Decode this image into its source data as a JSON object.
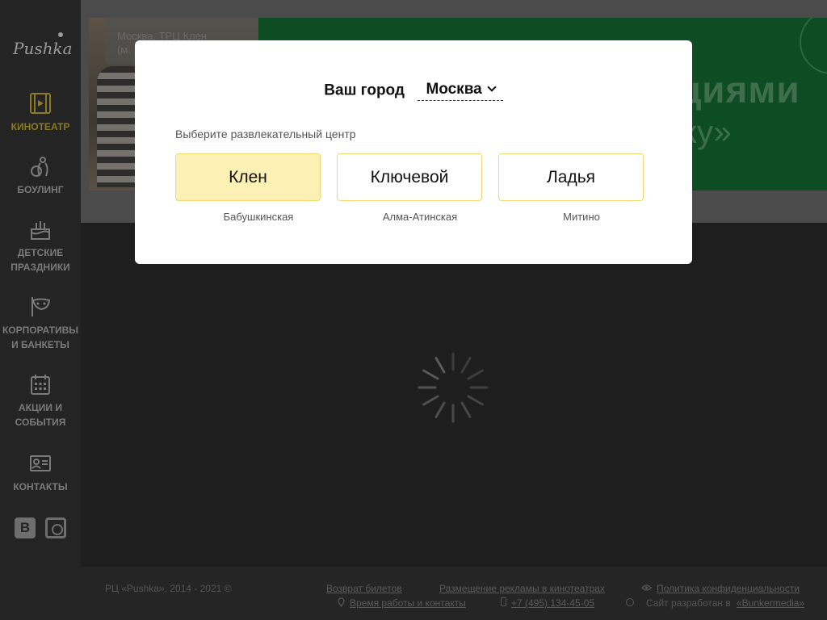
{
  "sidebar": {
    "logo": "Pushka",
    "items": [
      {
        "label": "КИНОТЕАТР",
        "icon": "film-icon",
        "active": true
      },
      {
        "label": "БОУЛИНГ",
        "icon": "bowling-icon",
        "active": false
      },
      {
        "label": "ДЕТСКИЕ ПРАЗДНИКИ",
        "icon": "cake-icon",
        "active": false
      },
      {
        "label": "КОРПОРАТИВЫ И БАНКЕТЫ",
        "icon": "mask-icon",
        "active": false
      },
      {
        "label": "АКЦИИ И СОБЫТИЯ",
        "icon": "calendar-icon",
        "active": false
      },
      {
        "label": "КОНТАКТЫ",
        "icon": "contact-card-icon",
        "active": false
      }
    ],
    "socials": [
      {
        "name": "vk-icon",
        "label": "B"
      },
      {
        "name": "instagram-icon"
      }
    ]
  },
  "banner": {
    "location": "Москва, ТРЦ Клен",
    "location_sub": "(м.",
    "headline": "циями",
    "subline": "ку»"
  },
  "modal": {
    "city_label": "Ваш город",
    "city_value": "Москва",
    "subtitle": "Выберите развлекательный центр",
    "centers": [
      {
        "name": "Клен",
        "metro": "Бабушкинская",
        "selected": true
      },
      {
        "name": "Ключевой",
        "metro": "Алма-Атинская",
        "selected": false
      },
      {
        "name": "Ладья",
        "metro": "Митино",
        "selected": false
      }
    ]
  },
  "footer": {
    "copyright": "РЦ «Pushka», 2014 - 2021 ©",
    "refund": "Возврат билетов",
    "ads": "Размещение рекламы в кинотеатрах",
    "privacy": "Политика конфиденциальности",
    "hours": "Время работы и контакты",
    "phone": "+7 (495) 134-45-05",
    "dev_prefix": "Сайт разработан в",
    "dev_link": "«Bunkermedia»"
  },
  "colors": {
    "accent": "#f0d874",
    "selected_bg": "#fdf0b5",
    "active_nav": "#8c7a25",
    "banner_green": "#0e4d24"
  }
}
